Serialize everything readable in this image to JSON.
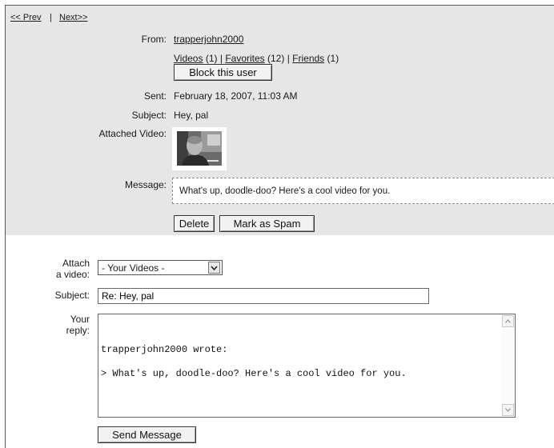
{
  "nav": {
    "prev": "<< Prev",
    "sep": "|",
    "next": "Next>>"
  },
  "message": {
    "from_label": "From:",
    "from_user": "trapperjohn2000",
    "videos_link": "Videos",
    "videos_count": "(1)",
    "favorites_link": "Favorites",
    "favorites_count": "(12)",
    "friends_link": "Friends",
    "friends_count": "(1)",
    "pipe": "|",
    "block_button": "Block this user",
    "sent_label": "Sent:",
    "sent_value": "February 18, 2007, 11:03 AM",
    "subject_label": "Subject:",
    "subject_value": "Hey, pal",
    "attached_label": "Attached Video:",
    "message_label": "Message:",
    "message_text": "What's up, doodle-doo? Here's a cool video for you.",
    "delete_button": "Delete",
    "spam_button": "Mark as Spam"
  },
  "reply": {
    "attach_label_1": "Attach",
    "attach_label_2": "a video:",
    "attach_selected": "- Your Videos -",
    "subject_label": "Subject:",
    "subject_value": "Re: Hey, pal",
    "reply_label_1": "Your",
    "reply_label_2": "reply:",
    "quote_header": "trapperjohn2000 wrote:",
    "quote_body": "> What's up, doodle-doo? Here's a cool video for you.",
    "send_button": "Send Message"
  },
  "icons": {
    "dropdown": "chevron-down-icon",
    "scroll_up": "scroll-up-icon",
    "scroll_down": "scroll-down-icon"
  }
}
